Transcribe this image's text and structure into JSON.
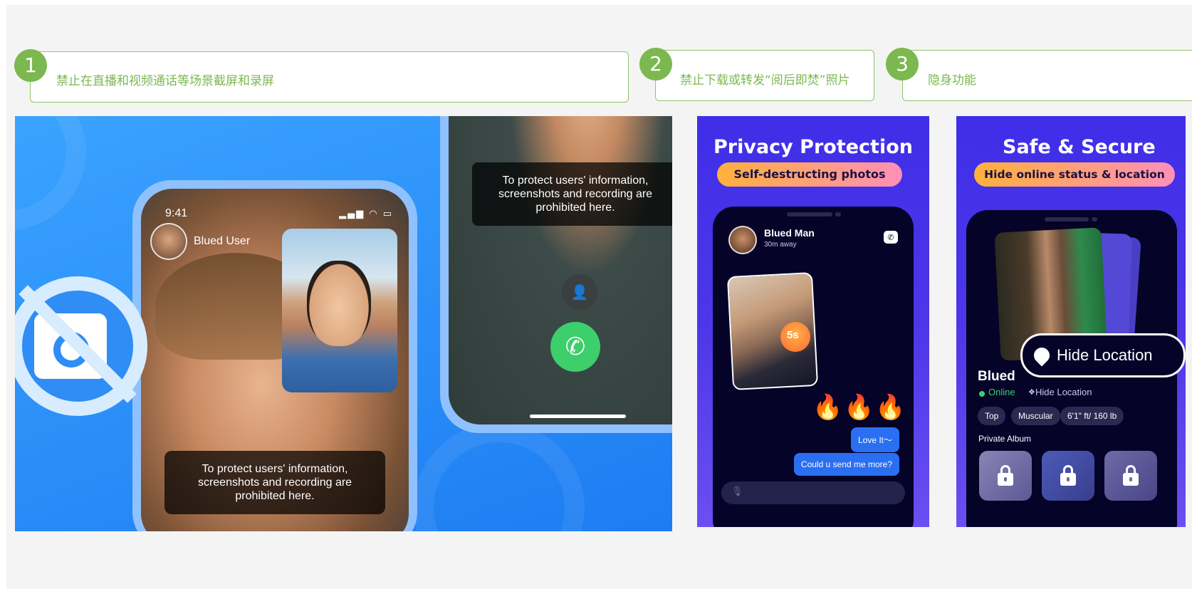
{
  "steps": [
    {
      "number": "1",
      "label": "禁止在直播和视频通话等场景截屏和录屏"
    },
    {
      "number": "2",
      "label": "禁止下载或转发“阅后即焚”照片"
    },
    {
      "number": "3",
      "label": "隐身功能"
    }
  ],
  "panel1": {
    "status_time": "9:41",
    "status_icons": "▂▄▆ ◠ ▭",
    "user_name": "Blued User",
    "toast_text": "To protect users' information, screenshots and recording are prohibited here.",
    "toast_text_right": "To protect users' information, screenshots and recording are prohibited here.",
    "colors": {
      "accent": "#2f8df5",
      "call_green": "#3ccf6b"
    }
  },
  "panel2": {
    "headline": "Privacy Protection",
    "banner": "Self-destructing photos",
    "contact_name": "Blued Man",
    "contact_distance": "30m away",
    "timer_badge": "5s",
    "fire_emojis": [
      "🔥",
      "🔥",
      "🔥"
    ],
    "messages": [
      "Love It～",
      "Could u send me more?"
    ]
  },
  "panel3": {
    "headline": "Safe & Secure",
    "banner": "Hide online status & location",
    "hide_location_button": "Hide Location",
    "name_partial": "Blued",
    "status_online": "Online",
    "status_hide_location": "Hide Location",
    "tags": [
      "Top",
      "Muscular",
      "6'1\" ft/ 160 lb"
    ],
    "private_album_label": "Private Album"
  }
}
